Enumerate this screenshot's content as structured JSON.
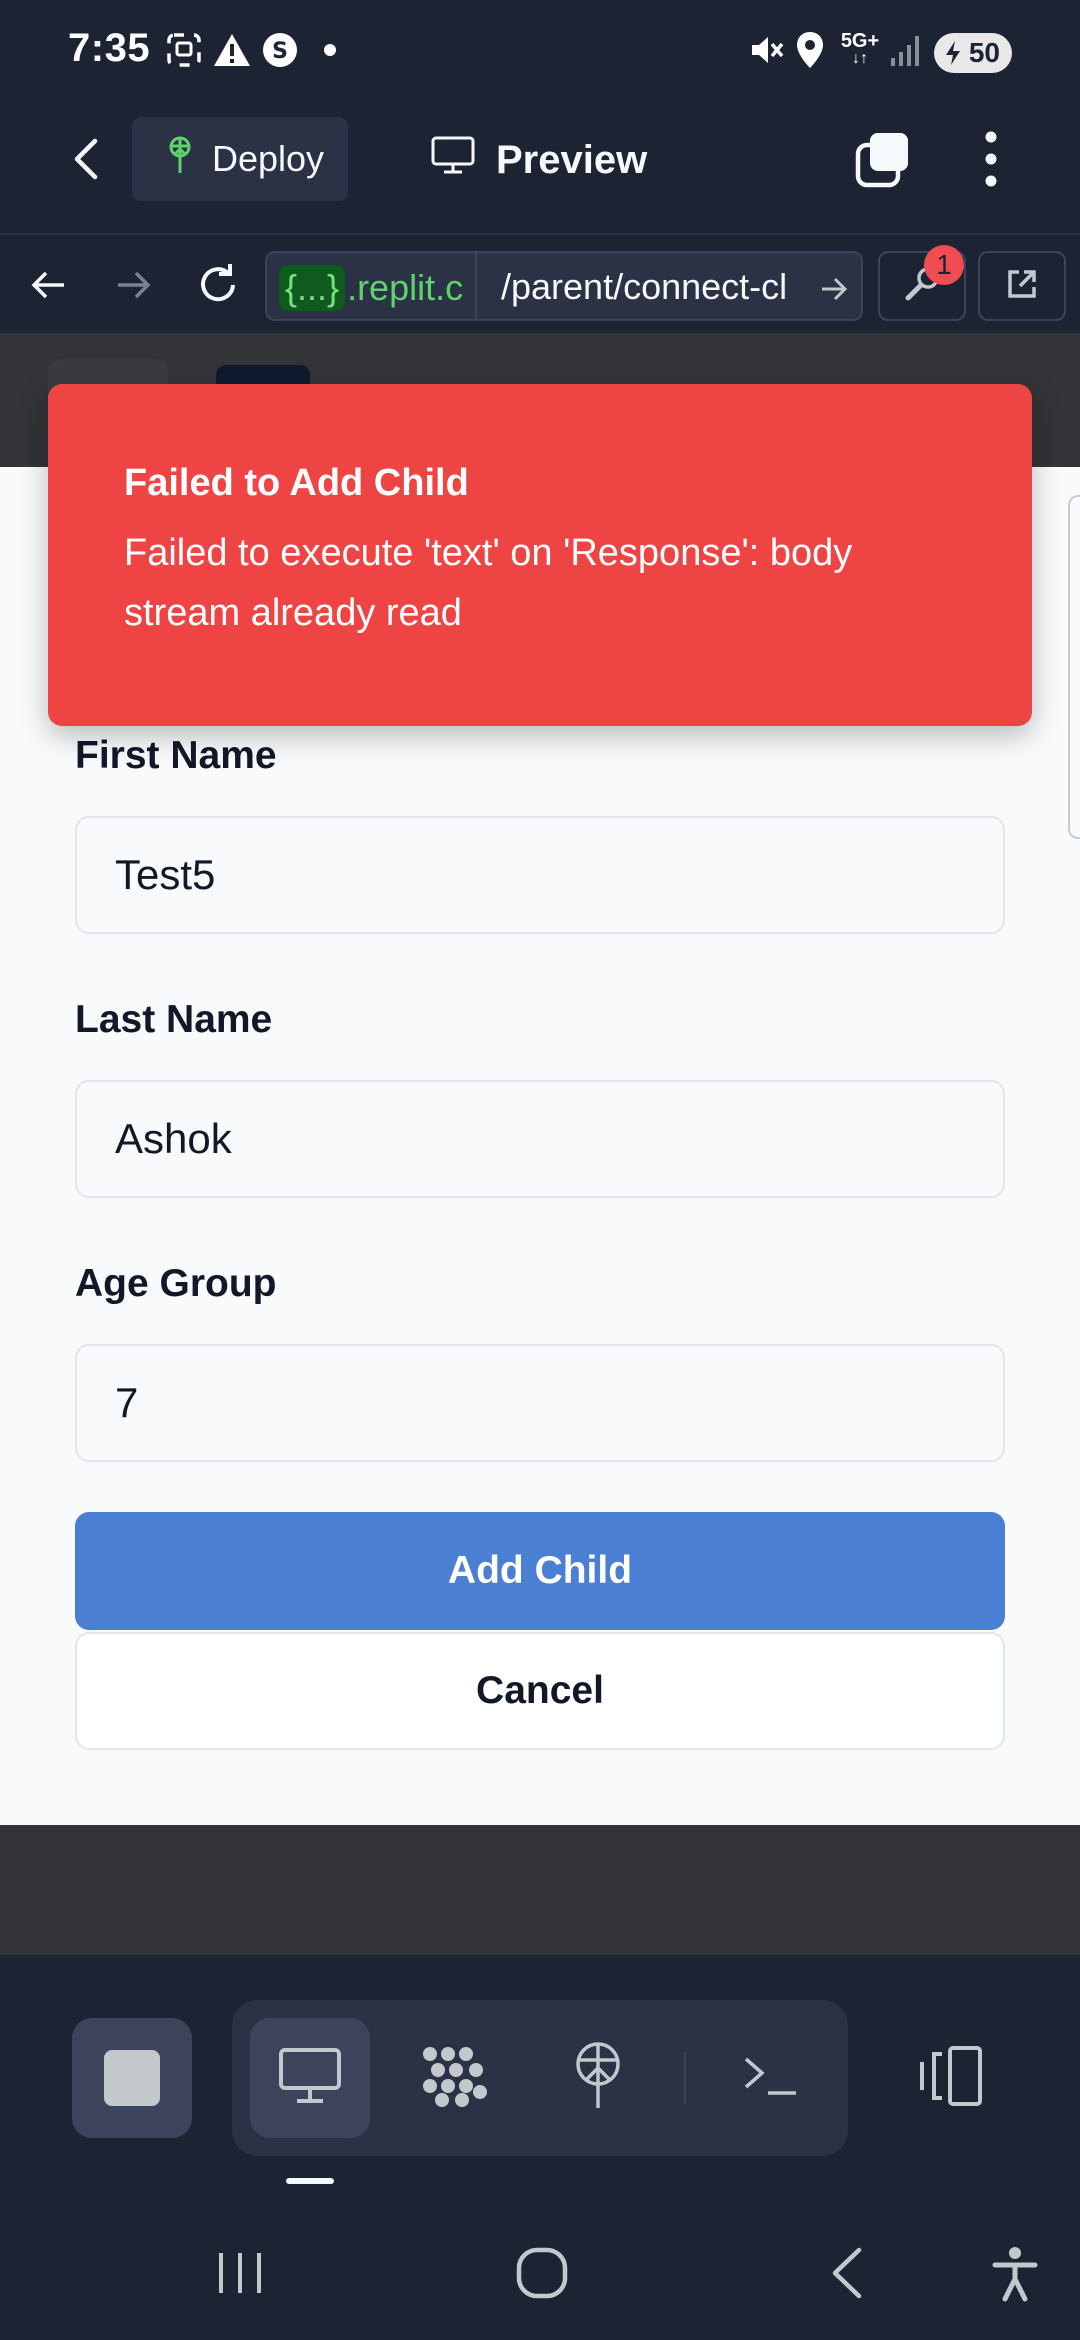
{
  "status_bar": {
    "time": "7:35",
    "battery_level": "50",
    "network": "5G+",
    "icons": [
      "screenshot-icon",
      "alert-icon",
      "shazam-icon",
      "dot-icon",
      "mute-icon",
      "location-icon",
      "signal-icon",
      "battery-icon"
    ]
  },
  "app_bar": {
    "deploy_label": "Deploy",
    "preview_label": "Preview"
  },
  "url_bar": {
    "domain_badge": "{...}",
    "domain_text": ".replit.c",
    "path": "/parent/connect-cl",
    "notification_count": "1"
  },
  "toast": {
    "title": "Failed to Add Child",
    "message": "Failed to execute 'text' on 'Response': body stream already read",
    "color": "#ef4444"
  },
  "form": {
    "first_name_label": "First Name",
    "first_name_value": "Test5",
    "last_name_label": "Last Name",
    "last_name_value": "Ashok",
    "age_group_label": "Age Group",
    "age_group_value": "7",
    "submit_label": "Add Child",
    "cancel_label": "Cancel",
    "submit_color": "#4a7fd4"
  },
  "toolbar": {
    "icons": [
      "stop-icon",
      "preview-icon",
      "workflows-icon",
      "deployments-icon",
      "shell-icon",
      "devices-icon"
    ]
  },
  "nav": {
    "icons": [
      "recent-apps-icon",
      "home-icon",
      "back-icon",
      "accessibility-icon"
    ]
  }
}
